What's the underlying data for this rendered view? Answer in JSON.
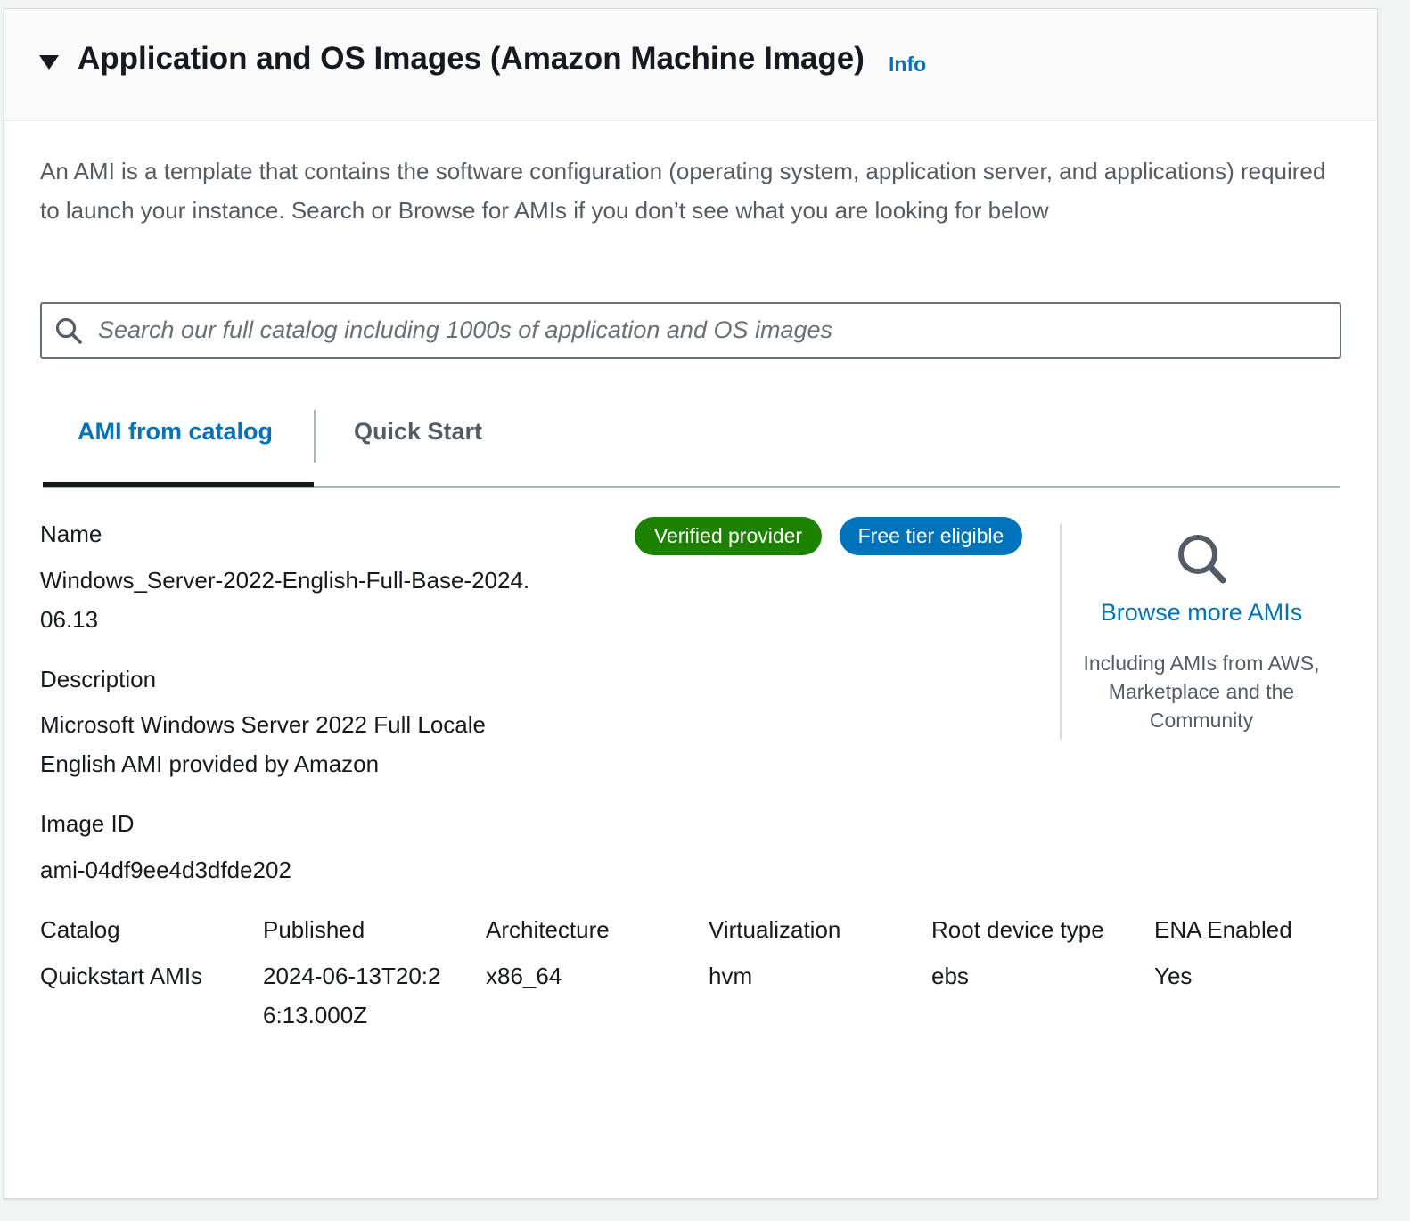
{
  "section": {
    "title": "Application and OS Images (Amazon Machine Image)",
    "info_label": "Info",
    "description": "An AMI is a template that contains the software configuration (operating system, application server, and applications) required to launch your instance. Search or Browse for AMIs if you don’t see what you are looking for below"
  },
  "search": {
    "placeholder": "Search our full catalog including 1000s of application and OS images"
  },
  "tabs": [
    {
      "label": "AMI from catalog",
      "selected": true
    },
    {
      "label": "Quick Start",
      "selected": false
    }
  ],
  "ami": {
    "name_label": "Name",
    "name_value": "Windows_Server-2022-English-Full-Base-2024.06.13",
    "description_label": "Description",
    "description_value": "Microsoft Windows Server 2022 Full Locale English AMI provided by Amazon",
    "image_id_label": "Image ID",
    "image_id_value": "ami-04df9ee4d3dfde202",
    "badges": {
      "verified": "Verified provider",
      "free_tier": "Free tier eligible"
    },
    "details": [
      {
        "label": "Catalog",
        "value": "Quickstart AMIs"
      },
      {
        "label": "Published",
        "value": "2024-06-13T20:26:13.000Z"
      },
      {
        "label": "Architecture",
        "value": "x86_64"
      },
      {
        "label": "Virtualization",
        "value": "hvm"
      },
      {
        "label": "Root device type",
        "value": "ebs"
      },
      {
        "label": "ENA Enabled",
        "value": "Yes"
      }
    ]
  },
  "browse": {
    "link_label": "Browse more AMIs",
    "description": "Including AMIs from AWS, Marketplace and the Community"
  },
  "colors": {
    "link": "#0073bb",
    "verified_badge": "#1d8102",
    "free_tier_badge": "#0073bb",
    "text": "#16191f",
    "secondary_text": "#545b64"
  },
  "icons": {
    "collapse": "caret-down-icon",
    "search": "search-icon",
    "browse": "magnifier-icon"
  }
}
